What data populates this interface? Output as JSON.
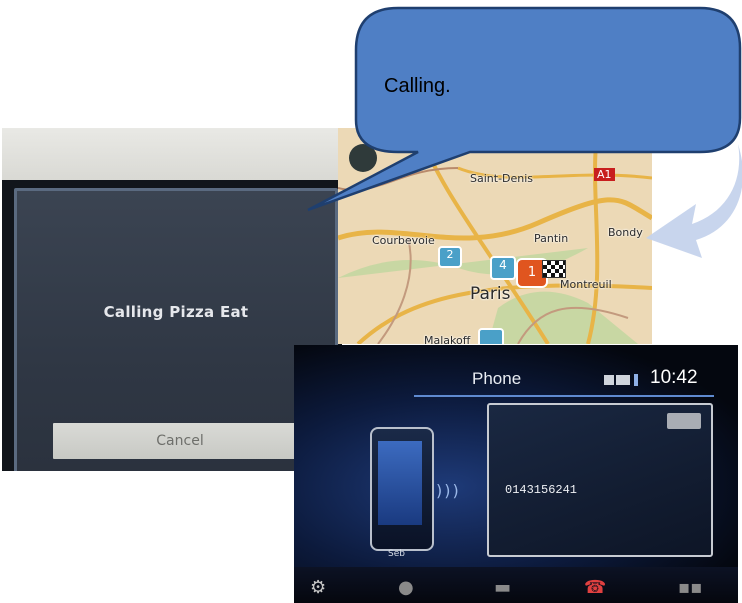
{
  "callout": {
    "text": "Calling."
  },
  "call_dialog": {
    "title": "Calling Pizza Eat",
    "cancel_label": "Cancel"
  },
  "map": {
    "places": {
      "saint_denis": "Saint-Denis",
      "courbevoie": "Courbevoie",
      "pantin": "Pantin",
      "bondy": "Bondy",
      "paris": "Paris",
      "montreuil": "Montreuil",
      "malakoff": "Malakoff",
      "road_a1": "A1"
    },
    "markers": [
      "2",
      "4",
      "1"
    ]
  },
  "phone": {
    "title": "Phone",
    "clock": "10:42",
    "dialed_number": "0143156241",
    "contact_name": "Seb"
  },
  "colors": {
    "callout_fill": "#4f7fc5",
    "callout_border": "#1f3f6f",
    "arrow_fill": "#c5d3ec",
    "dialog_bg": "#2f3744",
    "phone_accent": "#5f8ad0"
  }
}
